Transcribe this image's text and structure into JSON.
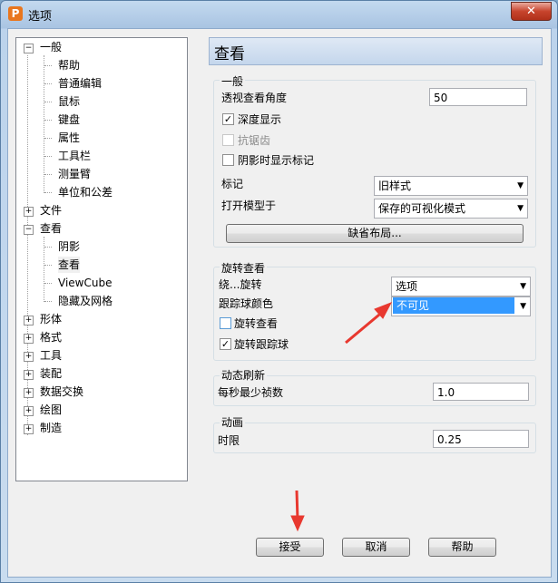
{
  "window": {
    "title": "选项",
    "close_label": "✕",
    "app_icon_letter": "P"
  },
  "tree": {
    "items": [
      {
        "label": "一般",
        "expander": "−"
      },
      {
        "label": "帮助"
      },
      {
        "label": "普通编辑"
      },
      {
        "label": "鼠标"
      },
      {
        "label": "键盘"
      },
      {
        "label": "属性"
      },
      {
        "label": "工具栏"
      },
      {
        "label": "测量臂"
      },
      {
        "label": "单位和公差"
      },
      {
        "label": "文件",
        "expander": "+"
      },
      {
        "label": "查看",
        "expander": "−"
      },
      {
        "label": "阴影"
      },
      {
        "label": "查看"
      },
      {
        "label": "ViewCube"
      },
      {
        "label": "隐藏及网格"
      },
      {
        "label": "形体",
        "expander": "+"
      },
      {
        "label": "格式",
        "expander": "+"
      },
      {
        "label": "工具",
        "expander": "+"
      },
      {
        "label": "装配",
        "expander": "+"
      },
      {
        "label": "数据交换",
        "expander": "+"
      },
      {
        "label": "绘图",
        "expander": "+"
      },
      {
        "label": "制造",
        "expander": "+"
      }
    ]
  },
  "panel": {
    "title": "查看",
    "general": {
      "title": "一般",
      "perspective_label": "透视查看角度",
      "perspective_value": "50",
      "depth_label": "深度显示",
      "depth_checked": "✓",
      "antialias_label": "抗锯齿",
      "shadow_marker_label": "阴影时显示标记",
      "marker_label": "标记",
      "marker_value": "旧样式",
      "open_model_label": "打开模型于",
      "open_model_value": "保存的可视化模式",
      "default_layout_button": "缺省布局..."
    },
    "rotate": {
      "title": "旋转查看",
      "around_label": "绕...旋转",
      "around_value": "选项",
      "ball_color_label": "跟踪球颜色",
      "ball_color_value": "不可见",
      "rotate_view_label": "旋转查看",
      "rotate_ball_label": "旋转跟踪球",
      "rotate_ball_checked": "✓"
    },
    "refresh": {
      "title": "动态刷新",
      "fps_label": "每秒最少祯数",
      "fps_value": "1.0"
    },
    "animation": {
      "title": "动画",
      "duration_label": "时限",
      "duration_value": "0.25"
    }
  },
  "buttons": {
    "accept": "接受",
    "cancel": "取消",
    "help": "帮助"
  },
  "colors": {
    "selection": "#3399ff",
    "annotation_arrow": "#e8382f"
  }
}
